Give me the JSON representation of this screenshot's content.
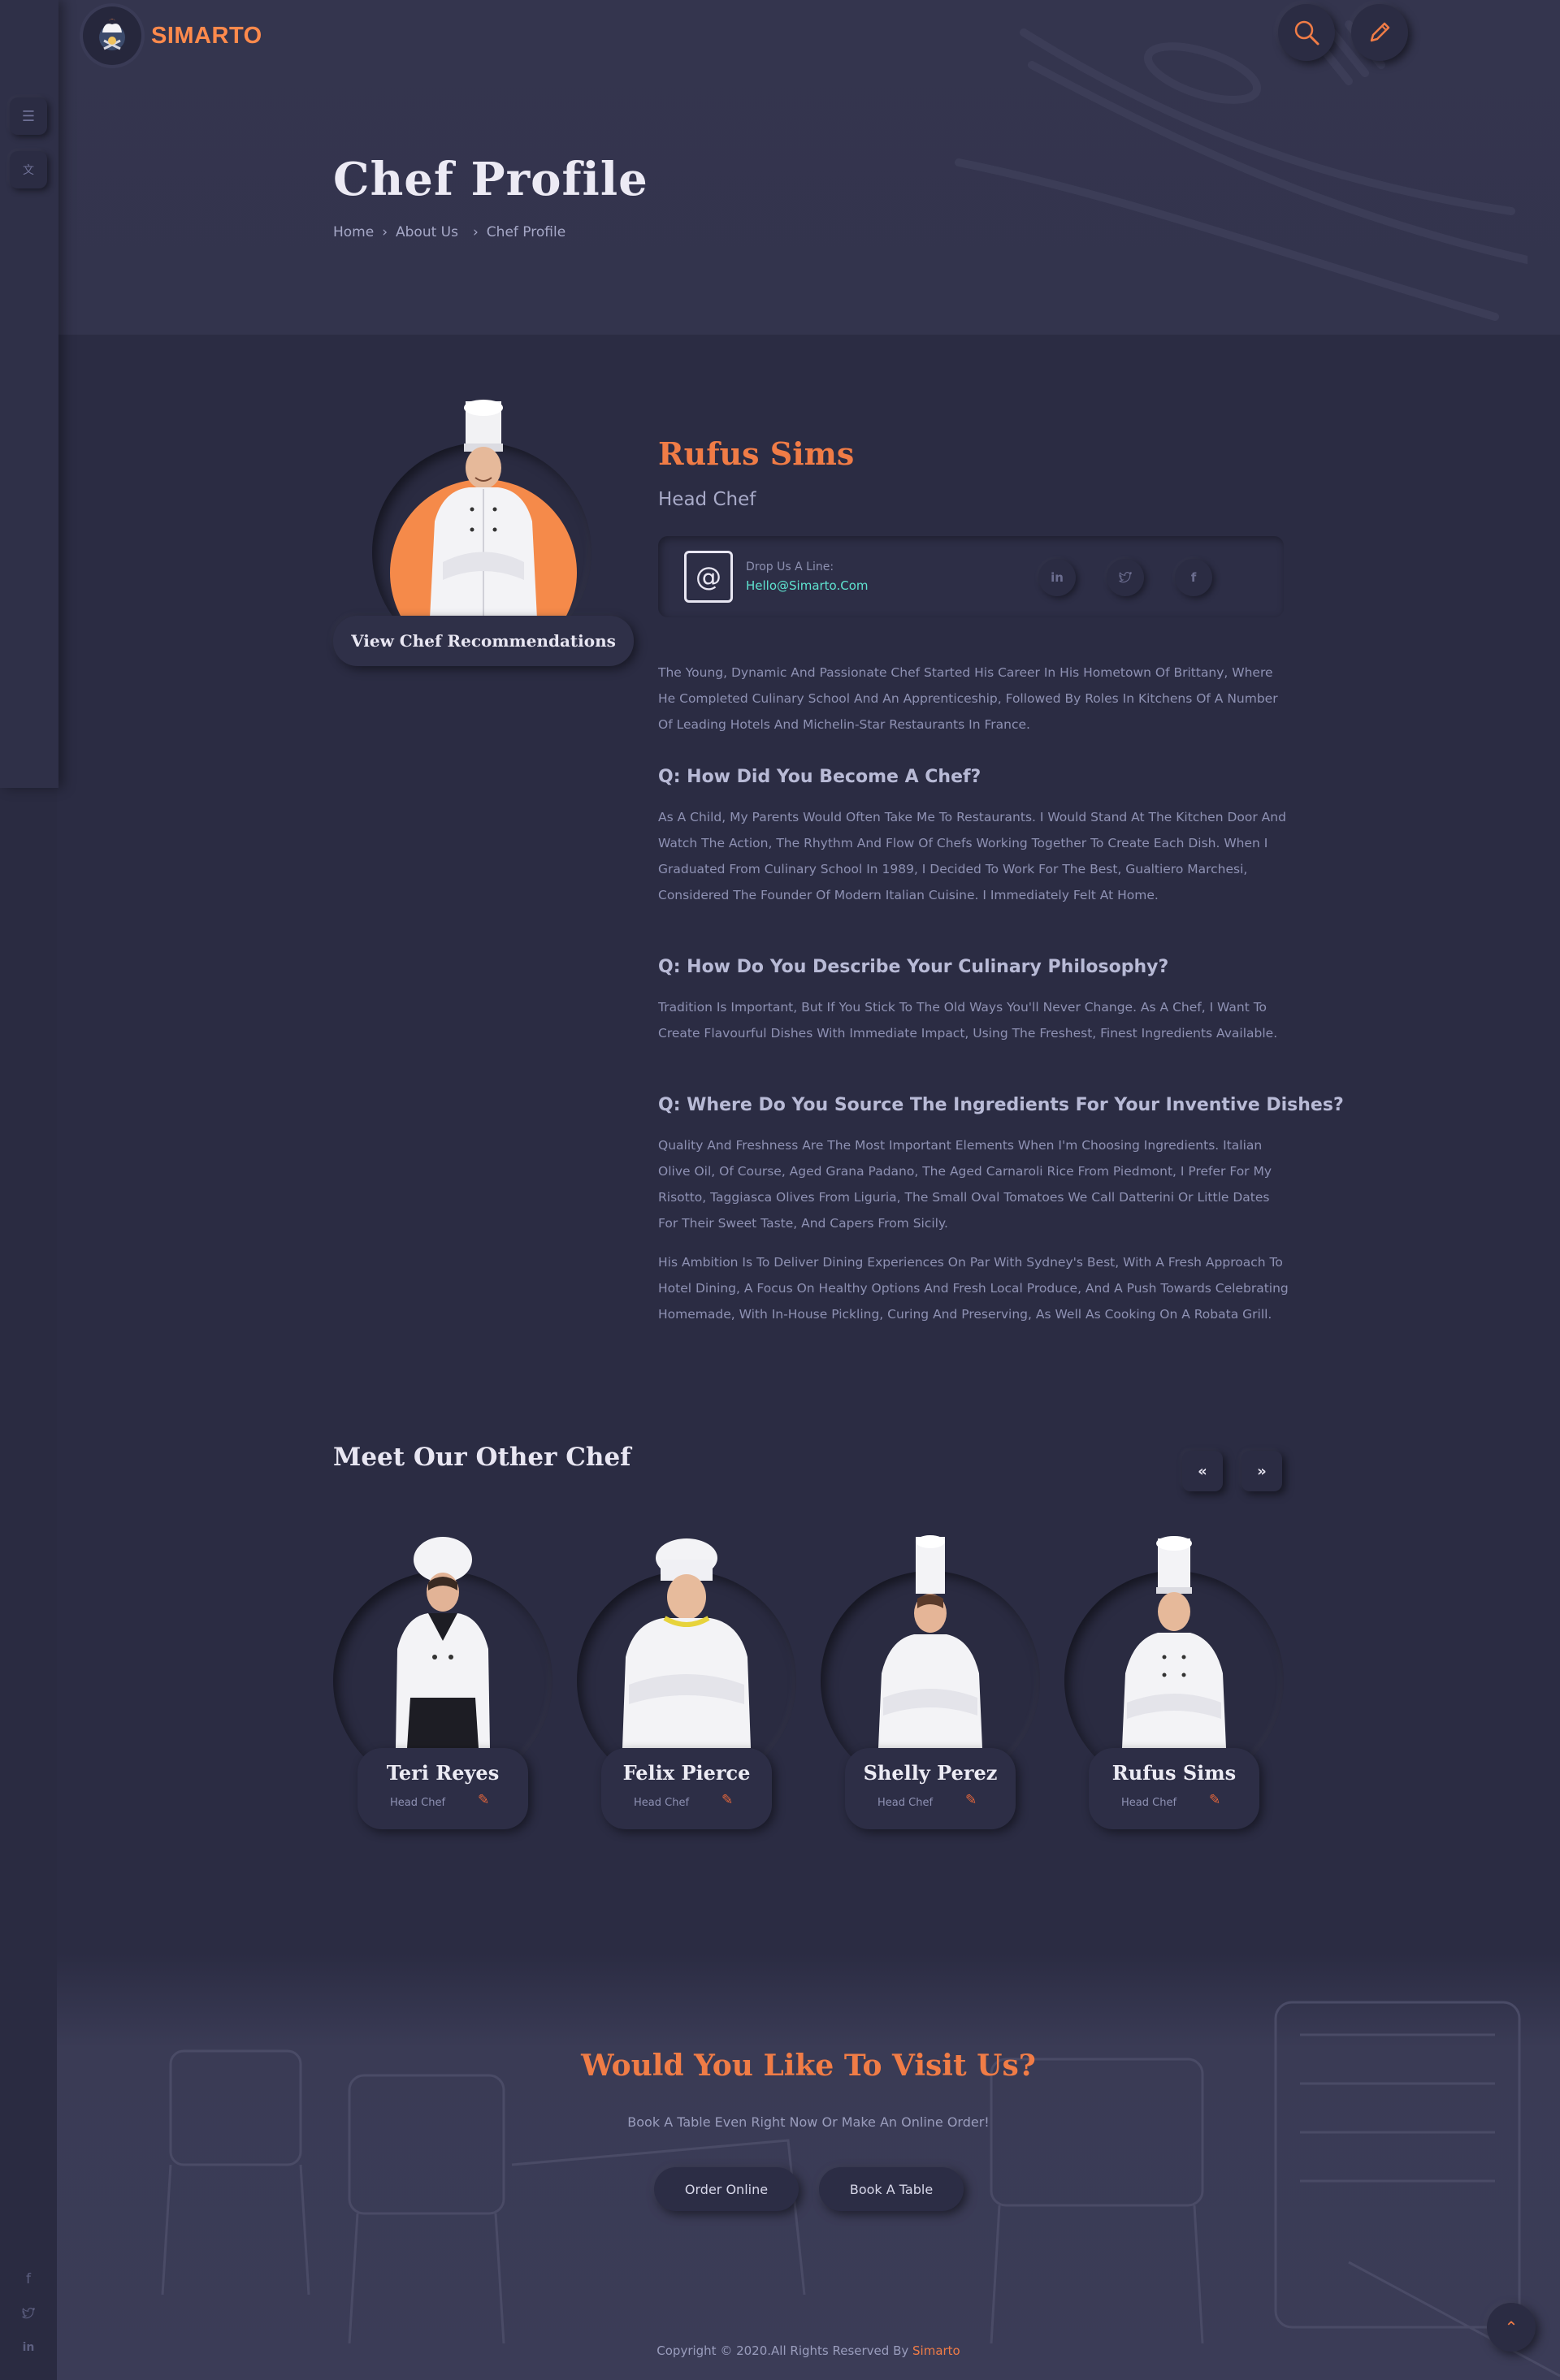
{
  "brand": {
    "name": "SIMARTO",
    "accent": "#ff8a4c"
  },
  "header": {
    "search_icon": "search-icon",
    "edit_icon": "pencil-icon"
  },
  "hero": {
    "title": "Chef Profile",
    "breadcrumb": [
      "Home",
      "About Us",
      "Chef Profile"
    ]
  },
  "profile": {
    "name": "Rufus Sims",
    "role": "Head Chef",
    "recommend_label": "View Chef Recommendations",
    "contact_label": "Drop Us A Line:",
    "contact_email": "Hello@Simarto.Com",
    "socials": [
      "in",
      "twitter",
      "f"
    ],
    "intro": "The Young, Dynamic And Passionate Chef Started His Career In His Hometown Of Brittany, Where He Completed Culinary School And An Apprenticeship, Followed By Roles In Kitchens Of A Number Of Leading Hotels And Michelin-Star Restaurants In France.",
    "qa": [
      {
        "q": "Q: How Did You Become A Chef?",
        "a": "As A Child, My Parents Would Often Take Me To Restaurants. I Would Stand At The Kitchen Door And Watch The Action, The Rhythm And Flow Of Chefs Working Together To Create Each Dish. When I Graduated From Culinary School In 1989, I Decided To Work For The Best, Gualtiero Marchesi, Considered The Founder Of Modern Italian Cuisine. I Immediately Felt At Home."
      },
      {
        "q": "Q: How Do You Describe Your Culinary Philosophy?",
        "a": "Tradition Is Important, But If You Stick To The Old Ways You'll Never Change. As A Chef, I Want To Create Flavourful Dishes With Immediate Impact, Using The Freshest, Finest Ingredients Available."
      },
      {
        "q": "Q: Where Do You Source The Ingredients For Your Inventive Dishes?",
        "a": "Quality And Freshness Are The Most Important Elements When I'm Choosing Ingredients. Italian Olive Oil, Of Course, Aged Grana Padano, The Aged Carnaroli Rice From Piedmont, I Prefer For My Risotto, Taggiasca Olives From Liguria, The Small Oval Tomatoes We Call Datterini Or Little Dates For Their Sweet Taste, And Capers From Sicily."
      }
    ],
    "closing": "His Ambition Is To Deliver Dining Experiences On Par With Sydney's Best, With A Fresh Approach To Hotel Dining, A Focus On Healthy Options And Fresh Local Produce, And A Push Towards Celebrating Homemade, With In-House Pickling, Curing And Preserving, As Well As Cooking On A Robata Grill."
  },
  "other_chefs": {
    "title": "Meet Our Other Chef",
    "prev_label": "«",
    "next_label": "»",
    "items": [
      {
        "name": "Teri Reyes",
        "role": "Head Chef"
      },
      {
        "name": "Felix Pierce",
        "role": "Head Chef"
      },
      {
        "name": "Shelly Perez",
        "role": "Head Chef"
      },
      {
        "name": "Rufus Sims",
        "role": "Head Chef"
      }
    ]
  },
  "visit": {
    "title": "Would You Like To Visit Us?",
    "subtitle": "Book A Table Even Right Now Or Make An Online Order!",
    "order_label": "Order Online",
    "book_label": "Book A Table"
  },
  "footer": {
    "copyright": "Copyright © 2020.All Rights Reserved By",
    "brand": "Simarto"
  }
}
